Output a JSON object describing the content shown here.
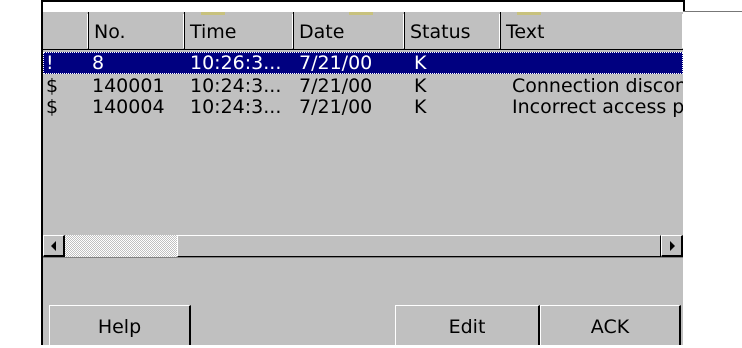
{
  "columns": [
    "",
    "No.",
    "Time",
    "Date",
    "Status",
    "Text"
  ],
  "rows": [
    {
      "flag": "!",
      "no": "8",
      "time": "10:26:3...",
      "date": "7/21/00",
      "status": "K",
      "text": ""
    },
    {
      "flag": "$",
      "no": "140001",
      "time": "10:24:3...",
      "date": "7/21/00",
      "status": "K",
      "text": "Connection discon"
    },
    {
      "flag": "$",
      "no": "140004",
      "time": "10:24:3...",
      "date": "7/21/00",
      "status": "K",
      "text": "Incorrect access p"
    }
  ],
  "selected_row": 0,
  "scrollbar": {
    "left_icon": "arrow-left-icon",
    "right_icon": "arrow-right-icon",
    "position": 1.0
  },
  "buttons": {
    "help": "Help",
    "edit": "Edit",
    "ack": "ACK"
  },
  "colors": {
    "panel": "#c0c0c0",
    "selection": "#000080",
    "selection_text": "#ffffff"
  }
}
